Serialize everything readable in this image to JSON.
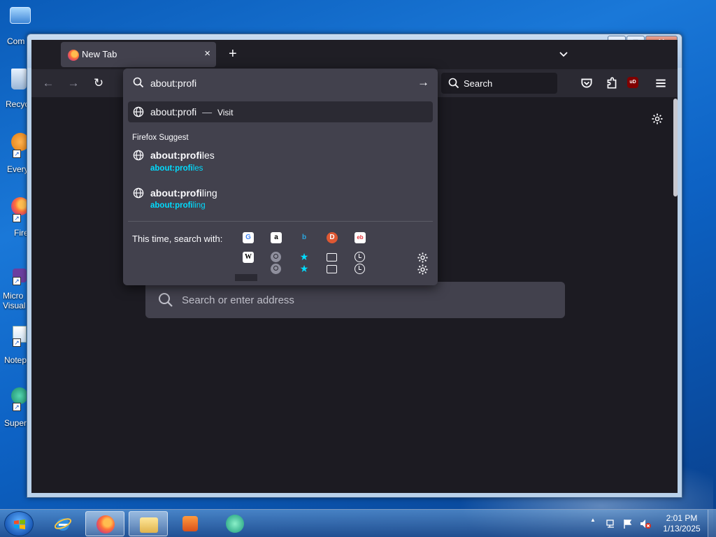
{
  "desktop": {
    "icons": [
      {
        "label": "Com",
        "icon": "computer-icon"
      },
      {
        "label": "Recyc",
        "icon": "recycle-bin-icon"
      },
      {
        "label": "Every",
        "icon": "everything-search-icon"
      },
      {
        "label": "Fire",
        "icon": "firefox-icon"
      },
      {
        "label": "Micro Visual",
        "icon": "visual-studio-icon"
      },
      {
        "label": "Notep",
        "icon": "notepad-icon"
      },
      {
        "label": "Super",
        "icon": "app-shortcut-icon"
      }
    ]
  },
  "window": {
    "controls": {
      "minimize": "‒",
      "maximize": "□",
      "close": "✕"
    }
  },
  "tabs": [
    {
      "title": "New Tab",
      "close": "×"
    }
  ],
  "newtab_button": "+",
  "tablist_button": "⌄",
  "navbar": {
    "back": "←",
    "forward": "→",
    "reload": "↻",
    "search_label": "Search"
  },
  "urlbar": {
    "value": "about:profi",
    "go_button": "→",
    "heuristic": {
      "title": "about:profi",
      "separator": "—",
      "action": "Visit"
    },
    "group_label": "Firefox Suggest",
    "suggestions": [
      {
        "title_bold": "about:profi",
        "title_rest": "les",
        "url_bold": "about:profi",
        "url_rest": "les"
      },
      {
        "title_bold": "about:profi",
        "title_rest": "ling",
        "url_bold": "about:profi",
        "url_rest": "ling"
      }
    ],
    "search_with_label": "This time, search with:",
    "engines": [
      {
        "name": "Google",
        "glyph": "G",
        "color": "#4285f4",
        "bg": "#ffffff"
      },
      {
        "name": "Amazon",
        "glyph": "a",
        "color": "#000000",
        "bg": "#ffffff"
      },
      {
        "name": "Bing",
        "glyph": "b",
        "color": "#2aa7e0",
        "bg": "transparent"
      },
      {
        "name": "DuckDuckGo",
        "glyph": "D",
        "color": "#ffffff",
        "bg": "#de5833"
      },
      {
        "name": "eBay",
        "glyph": "eb",
        "color": "#e53238",
        "bg": "#ffffff"
      },
      {
        "name": "Wikipedia",
        "glyph": "W",
        "color": "#000000",
        "bg": "#ffffff"
      }
    ]
  },
  "newtab_page": {
    "search_placeholder": "Search or enter address"
  },
  "taskbar": {
    "apps": [
      "internet-explorer-icon",
      "firefox-icon",
      "file-explorer-icon",
      "media-player-icon",
      "app-icon"
    ],
    "tray_arrow": "▲",
    "time": "2:01 PM",
    "date": "1/13/2025"
  },
  "colors": {
    "toolbar": "#2b2a33",
    "content": "#1c1b22",
    "popup": "#42414d",
    "suggest_url": "#00ddff"
  }
}
